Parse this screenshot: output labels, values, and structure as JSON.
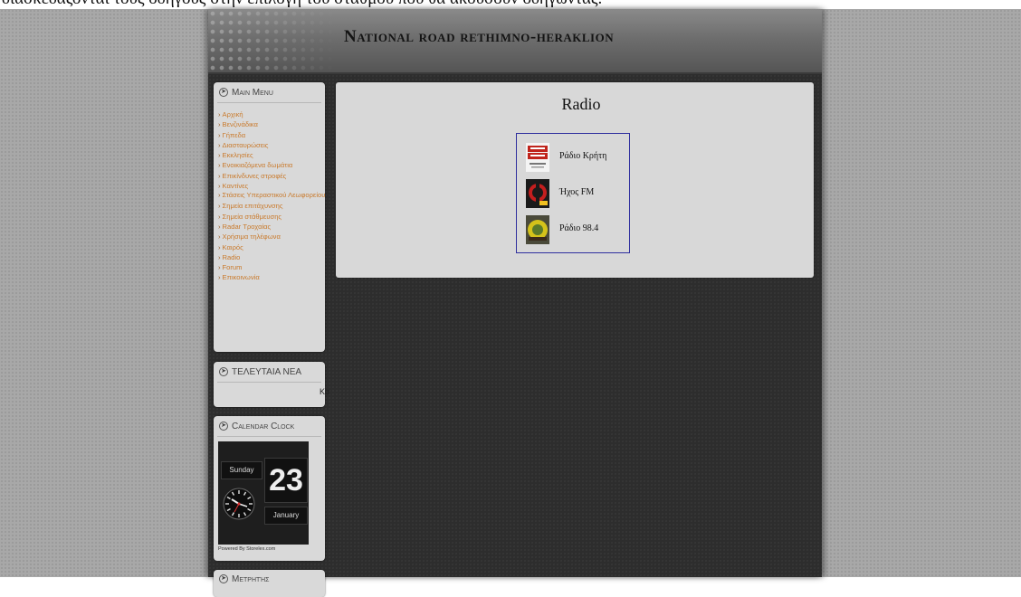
{
  "document_caption": "διασκεδάζονται τους οδηγούς στην επιλογή του σταθμού που θα ακούσουν οδηγώντας.",
  "site": {
    "title": "National road rethimno-heraklion"
  },
  "sidebar": {
    "main_menu": {
      "title": "Main Menu",
      "items": [
        {
          "label": "Αρχική"
        },
        {
          "label": "Βενζινάδικα"
        },
        {
          "label": "Γήπεδα"
        },
        {
          "label": "Διασταυρώσεις"
        },
        {
          "label": "Εκκλησίες"
        },
        {
          "label": "Ενοικιαζόμενα δωμάτια"
        },
        {
          "label": "Επικίνδυνες στροφές"
        },
        {
          "label": "Καντίνες"
        },
        {
          "label": "Στάσεις Υπεραστικού Λεωφορείου"
        },
        {
          "label": "Σημεία επιτάχυνσης"
        },
        {
          "label": "Σημεία στάθμευσης"
        },
        {
          "label": "Radar Τροχαίας"
        },
        {
          "label": "Χρήσιμα τηλέφωνα"
        },
        {
          "label": "Καιρός"
        },
        {
          "label": "Radio"
        },
        {
          "label": "Forum"
        },
        {
          "label": "Επικοινωνία"
        }
      ]
    },
    "latest_news": {
      "title": "ΤΕΛΕΥΤΑΙΑ ΝΕΑ",
      "ticker": "Κα"
    },
    "calendar_clock": {
      "title": "Calendar Clock",
      "day": "Sunday",
      "date": "23",
      "month": "January",
      "powered_by": "Powered By Storelex.com"
    },
    "next_box": {
      "title": "Μετρητής"
    }
  },
  "main": {
    "title": "Radio",
    "stations": [
      {
        "name": "Ράδιο Κρήτη",
        "icon": "radio-kriti-logo"
      },
      {
        "name": "Ήχος FM",
        "icon": "ixos-fm-logo"
      },
      {
        "name": "Ράδιο 98.4",
        "icon": "radio-984-logo"
      }
    ]
  },
  "colors": {
    "menu_link": "#c97a2c",
    "box_bg": "#d9d9d9",
    "page_bg": "#2d2d2d",
    "radio_border": "#2f2f9e"
  }
}
